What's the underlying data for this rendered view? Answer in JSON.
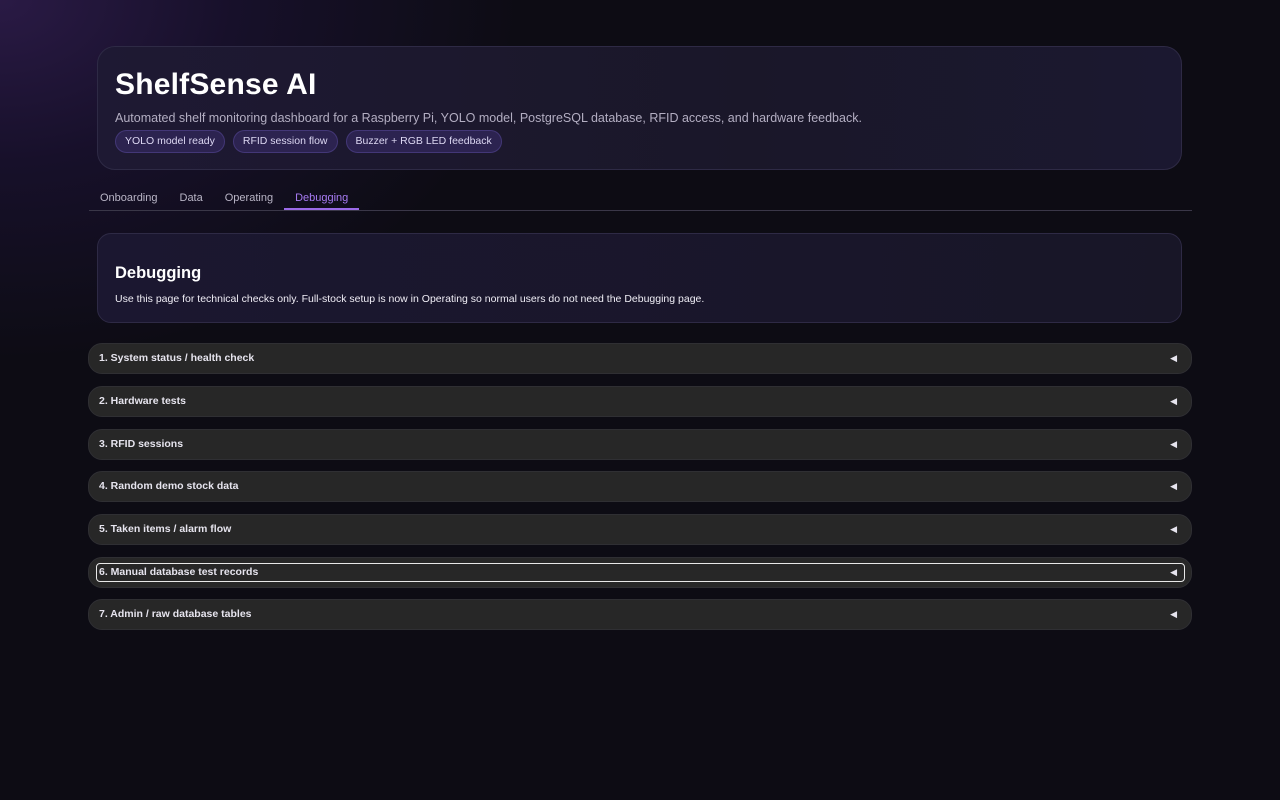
{
  "header": {
    "title": "ShelfSense AI",
    "subtitle": "Automated shelf monitoring dashboard for a Raspberry Pi, YOLO model, PostgreSQL database, RFID access, and hardware feedback.",
    "badges": [
      "YOLO model ready",
      "RFID session flow",
      "Buzzer + RGB LED feedback"
    ]
  },
  "tabs": [
    {
      "label": "Onboarding",
      "active": false
    },
    {
      "label": "Data",
      "active": false
    },
    {
      "label": "Operating",
      "active": false
    },
    {
      "label": "Debugging",
      "active": true
    }
  ],
  "panel": {
    "title": "Debugging",
    "text": "Use this page for technical checks only. Full-stock setup is now in Operating so normal users do not need the Debugging page."
  },
  "sections": [
    {
      "label": "1. System status / health check",
      "arrow": "◀"
    },
    {
      "label": "2. Hardware tests",
      "arrow": "◀"
    },
    {
      "label": "3. RFID sessions",
      "arrow": "◀"
    },
    {
      "label": "4. Random demo stock data",
      "arrow": "◀"
    },
    {
      "label": "5. Taken items / alarm flow",
      "arrow": "◀"
    },
    {
      "label": "6. Manual database test records",
      "arrow": "◀"
    },
    {
      "label": "7. Admin / raw database tables",
      "arrow": "◀"
    }
  ],
  "colors": {
    "accent": "#9b6ae8",
    "badge_bg": "#2c2350",
    "accordion_bg": "#272727",
    "page_bg": "#0d0c14"
  }
}
